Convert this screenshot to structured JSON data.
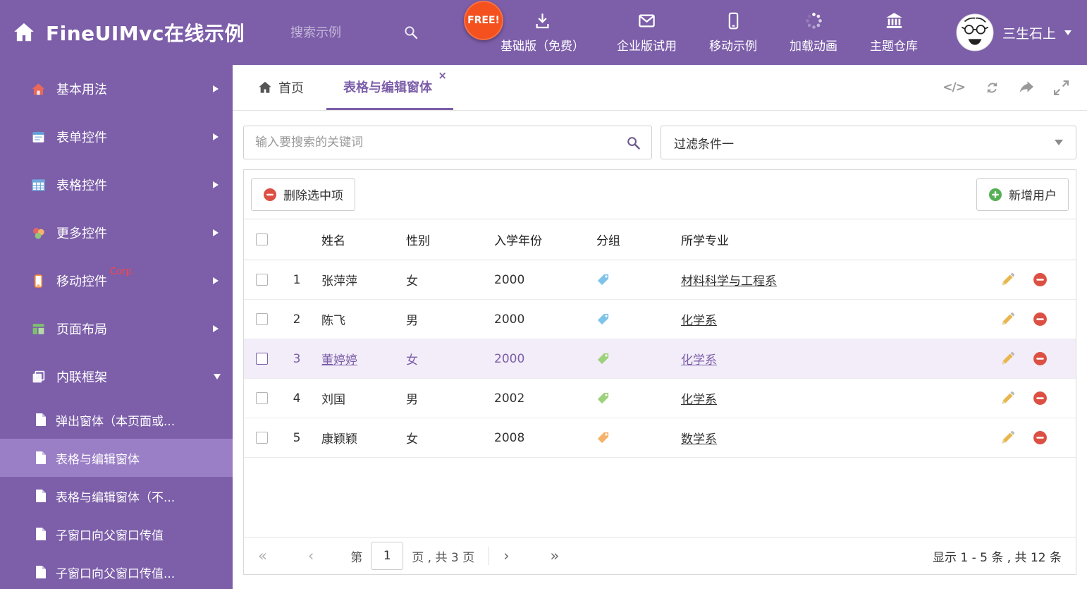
{
  "colors": {
    "purple": "#7c5ea9",
    "free_badge": "#f4511e",
    "tag_blue": "#7ec3ea",
    "tag_green": "#9ed17b",
    "tag_orange": "#f5b26b",
    "delete_red": "#dc5044",
    "add_green": "#55b055",
    "selected_row_bg": "#f2edf8"
  },
  "icons": {
    "close": "×",
    "code": "</>",
    "first_page": "«",
    "prev_page": "‹",
    "next_page": "›",
    "last_page": "»"
  },
  "header": {
    "title": "FineUIMvc在线示例",
    "search_placeholder": "搜索示例",
    "free_badge": "FREE!",
    "nav": [
      {
        "label": "基础版（免费）",
        "icon": "download-icon"
      },
      {
        "label": "企业版试用",
        "icon": "envelope-icon"
      },
      {
        "label": "移动示例",
        "icon": "mobile-icon"
      },
      {
        "label": "加载动画",
        "icon": "spinner-icon"
      },
      {
        "label": "主题仓库",
        "icon": "bank-icon"
      }
    ],
    "user": "三生石上"
  },
  "sidebar": {
    "items": [
      {
        "label": "基本用法",
        "icon": "home-icon"
      },
      {
        "label": "表单控件",
        "icon": "form-icon"
      },
      {
        "label": "表格控件",
        "icon": "table-icon"
      },
      {
        "label": "更多控件",
        "icon": "widgets-icon"
      },
      {
        "label": "移动控件",
        "badge": "Corp.",
        "icon": "mobile-icon"
      },
      {
        "label": "页面布局",
        "icon": "layout-icon"
      },
      {
        "label": "内联框架",
        "icon": "frame-icon",
        "expanded": true
      }
    ],
    "subitems": [
      {
        "label": "弹出窗体（本页面或...",
        "active": false
      },
      {
        "label": "表格与编辑窗体",
        "active": true
      },
      {
        "label": "表格与编辑窗体（不...",
        "active": false
      },
      {
        "label": "子窗口向父窗口传值",
        "active": false
      },
      {
        "label": "子窗口向父窗口传值...",
        "active": false
      }
    ]
  },
  "tabs": {
    "home_label": "首页",
    "active_label": "表格与编辑窗体"
  },
  "filters": {
    "search_placeholder": "输入要搜索的关键词",
    "dropdown_value": "过滤条件一"
  },
  "toolbar": {
    "delete_label": "删除选中项",
    "add_label": "新增用户"
  },
  "table": {
    "columns": [
      "姓名",
      "性别",
      "入学年份",
      "分组",
      "所学专业"
    ],
    "rows": [
      {
        "num": "1",
        "name": "张萍萍",
        "gender": "女",
        "year": "2000",
        "tag_color": "#7ec3ea",
        "major": "材料科学与工程系",
        "selected": false
      },
      {
        "num": "2",
        "name": "陈飞",
        "gender": "男",
        "year": "2000",
        "tag_color": "#7ec3ea",
        "major": "化学系",
        "selected": false
      },
      {
        "num": "3",
        "name": "董婷婷",
        "gender": "女",
        "year": "2000",
        "tag_color": "#9ed17b",
        "major": "化学系",
        "selected": true
      },
      {
        "num": "4",
        "name": "刘国",
        "gender": "男",
        "year": "2002",
        "tag_color": "#9ed17b",
        "major": "化学系",
        "selected": false
      },
      {
        "num": "5",
        "name": "康颖颖",
        "gender": "女",
        "year": "2008",
        "tag_color": "#f5b26b",
        "major": "数学系",
        "selected": false
      }
    ]
  },
  "pagination": {
    "page_label_prefix": "第",
    "page_value": "1",
    "page_label_suffix": "页 , 共 3 页",
    "summary": "显示 1 - 5 条 , 共 12 条"
  }
}
